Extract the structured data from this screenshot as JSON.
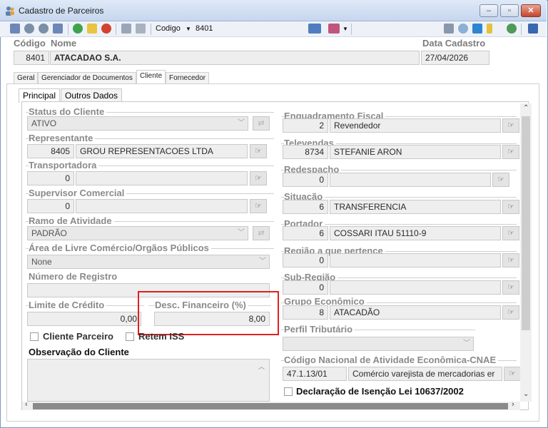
{
  "window": {
    "title": "Cadastro de Parceiros"
  },
  "toolbar": {
    "codigo_label": "Codigo",
    "codigo_value": "8401"
  },
  "header": {
    "codigo_label": "Código",
    "nome_label": "Nome",
    "data_cadastro_label": "Data Cadastro",
    "codigo": "8401",
    "nome": "ATACADAO S.A.",
    "data_cadastro": "27/04/2026"
  },
  "tabs": [
    "Geral",
    "Gerenciador de Documentos",
    "Cliente",
    "Fornecedor"
  ],
  "subtabs": [
    "Principal",
    "Outros Dados"
  ],
  "left": {
    "status_label": "Status do Cliente",
    "status_value": "ATIVO",
    "representante_label": "Representante",
    "representante_code": "8405",
    "representante_name": "GROU REPRESENTACOES LTDA",
    "transportadora_label": "Transportadora",
    "transportadora_code": "0",
    "supervisor_label": "Supervisor Comercial",
    "supervisor_code": "0",
    "ramo_label": "Ramo de Atividade",
    "ramo_value": "PADRÃO",
    "area_label": "Área de Livre Comércio/Orgãos Públicos",
    "area_value": "None",
    "numero_registro_label": "Número de Registro",
    "limite_label": "Limite de Crédito",
    "limite_value": "0,00",
    "desc_label": "Desc. Financeiro (%)",
    "desc_value": "8,00",
    "cliente_parceiro_label": "Cliente Parceiro",
    "retem_iss_label": "Retem ISS",
    "observacao_label": "Observação do Cliente"
  },
  "right": {
    "enquadramento_label": "Enquadramento Fiscal",
    "enquadramento_code": "2",
    "enquadramento_name": "Revendedor",
    "televendas_label": "Televendas",
    "televendas_code": "8734",
    "televendas_name": "STEFANIE ARON",
    "redespacho_label": "Redespacho",
    "redespacho_code": "0",
    "situacao_label": "Situação",
    "situacao_code": "6",
    "situacao_name": "TRANSFERENCIA",
    "portador_label": "Portador",
    "portador_code": "6",
    "portador_name": "COSSARI ITAU 51110-9",
    "regiao_label": "Região a que pertence",
    "regiao_code": "0",
    "subregiao_label": "Sub-Região",
    "subregiao_code": "0",
    "grupo_label": "Grupo Econômico",
    "grupo_code": "8",
    "grupo_name": "ATACADÃO",
    "perfil_label": "Perfil Tributário",
    "cnae_label": "Código Nacional de Atividade Econômica-CNAE",
    "cnae_code": "47.1.13/01",
    "cnae_desc": "Comércio varejista de mercadorias er",
    "declaracao_label": "Declaração de Isenção Lei 10637/2002"
  },
  "colors": {
    "highlight": "#e0211f",
    "accent": "#1f6fc5"
  }
}
